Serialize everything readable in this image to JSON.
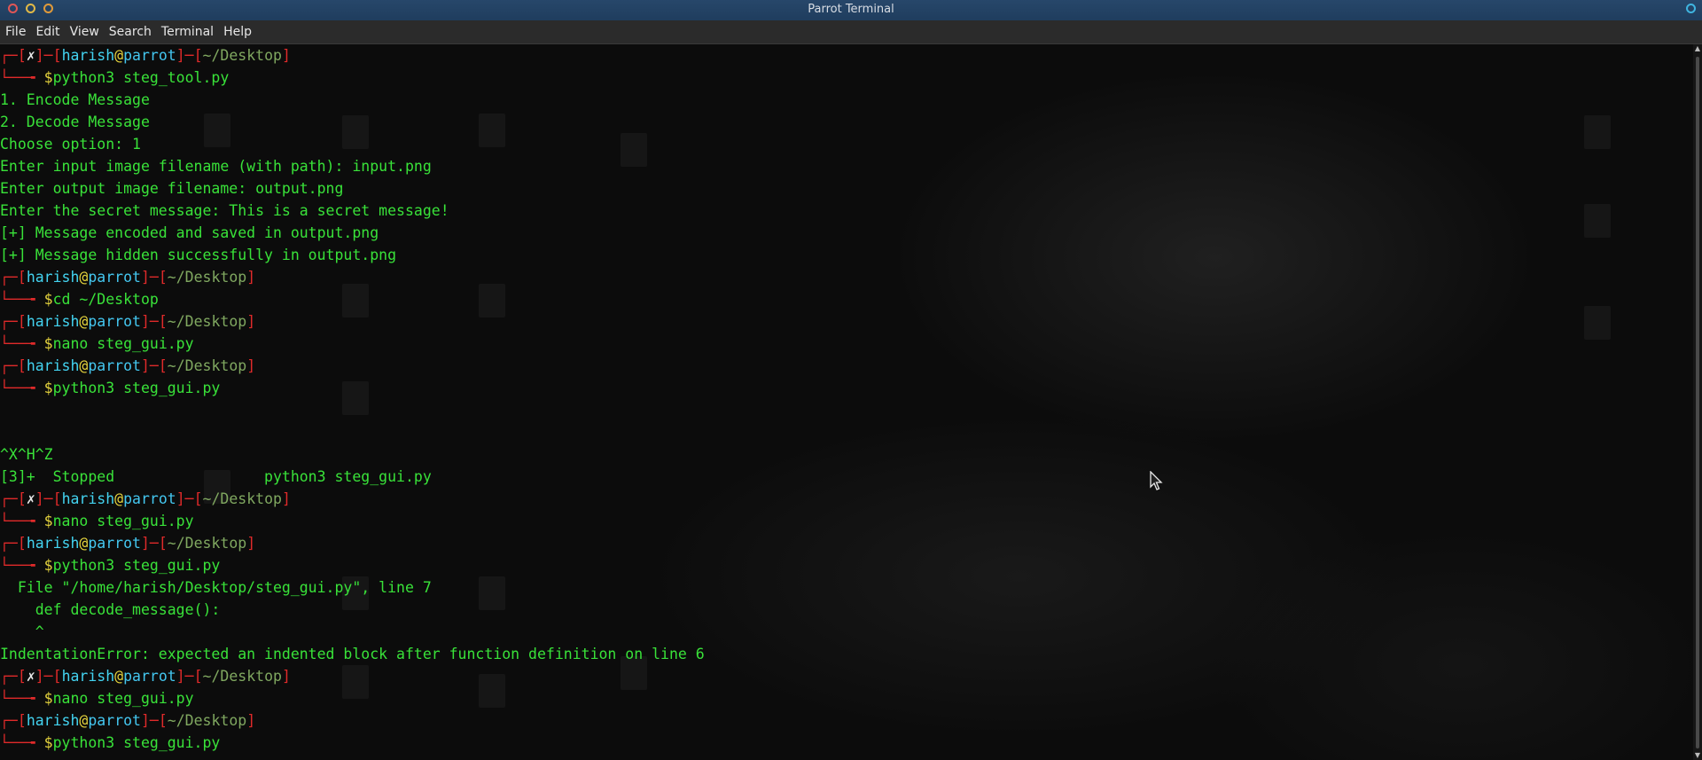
{
  "window": {
    "title": "Parrot Terminal"
  },
  "menu": [
    "File",
    "Edit",
    "View",
    "Search",
    "Terminal",
    "Help"
  ],
  "prompt": {
    "user": "harish",
    "at": "@",
    "host": "parrot",
    "path": "~/Desktop",
    "error_mark": "✗",
    "dollar": "$"
  },
  "terminal_lines": [
    {
      "type": "prompt_head",
      "error": true
    },
    {
      "type": "prompt_cmd",
      "cmd": "python3 steg_tool.py"
    },
    {
      "type": "out",
      "text": "1. Encode Message"
    },
    {
      "type": "out",
      "text": "2. Decode Message"
    },
    {
      "type": "out",
      "text": "Choose option: 1"
    },
    {
      "type": "out",
      "text": "Enter input image filename (with path): input.png"
    },
    {
      "type": "out",
      "text": "Enter output image filename: output.png"
    },
    {
      "type": "out",
      "text": "Enter the secret message: This is a secret message!"
    },
    {
      "type": "out",
      "text": "[+] Message encoded and saved in output.png"
    },
    {
      "type": "out",
      "text": "[+] Message hidden successfully in output.png"
    },
    {
      "type": "prompt_head",
      "error": false
    },
    {
      "type": "prompt_cmd",
      "cmd": "cd ~/Desktop"
    },
    {
      "type": "prompt_head",
      "error": false
    },
    {
      "type": "prompt_cmd",
      "cmd": "nano steg_gui.py"
    },
    {
      "type": "prompt_head",
      "error": false
    },
    {
      "type": "prompt_cmd",
      "cmd": "python3 steg_gui.py"
    },
    {
      "type": "out",
      "text": ""
    },
    {
      "type": "out",
      "text": ""
    },
    {
      "type": "out",
      "text": "^X^H^Z"
    },
    {
      "type": "out",
      "text": "[3]+  Stopped                 python3 steg_gui.py"
    },
    {
      "type": "prompt_head",
      "error": true
    },
    {
      "type": "prompt_cmd",
      "cmd": "nano steg_gui.py"
    },
    {
      "type": "prompt_head",
      "error": false
    },
    {
      "type": "prompt_cmd",
      "cmd": "python3 steg_gui.py"
    },
    {
      "type": "out",
      "text": "  File \"/home/harish/Desktop/steg_gui.py\", line 7"
    },
    {
      "type": "out",
      "text": "    def decode_message():"
    },
    {
      "type": "out",
      "text": "    ^"
    },
    {
      "type": "out",
      "text": "IndentationError: expected an indented block after function definition on line 6"
    },
    {
      "type": "prompt_head",
      "error": true
    },
    {
      "type": "prompt_cmd",
      "cmd": "nano steg_gui.py"
    },
    {
      "type": "prompt_head",
      "error": false
    },
    {
      "type": "prompt_cmd",
      "cmd": "python3 steg_gui.py"
    }
  ],
  "colors": {
    "prompt_bracket": "#e02a2a",
    "user_host": "#43d3f0",
    "path": "#80a860",
    "output": "#39e239",
    "dollar": "#e3d23d",
    "titlebar": "#27476a"
  },
  "icons": [
    "close-icon",
    "minimize-icon",
    "maximize-icon",
    "mouse-pointer-icon"
  ]
}
